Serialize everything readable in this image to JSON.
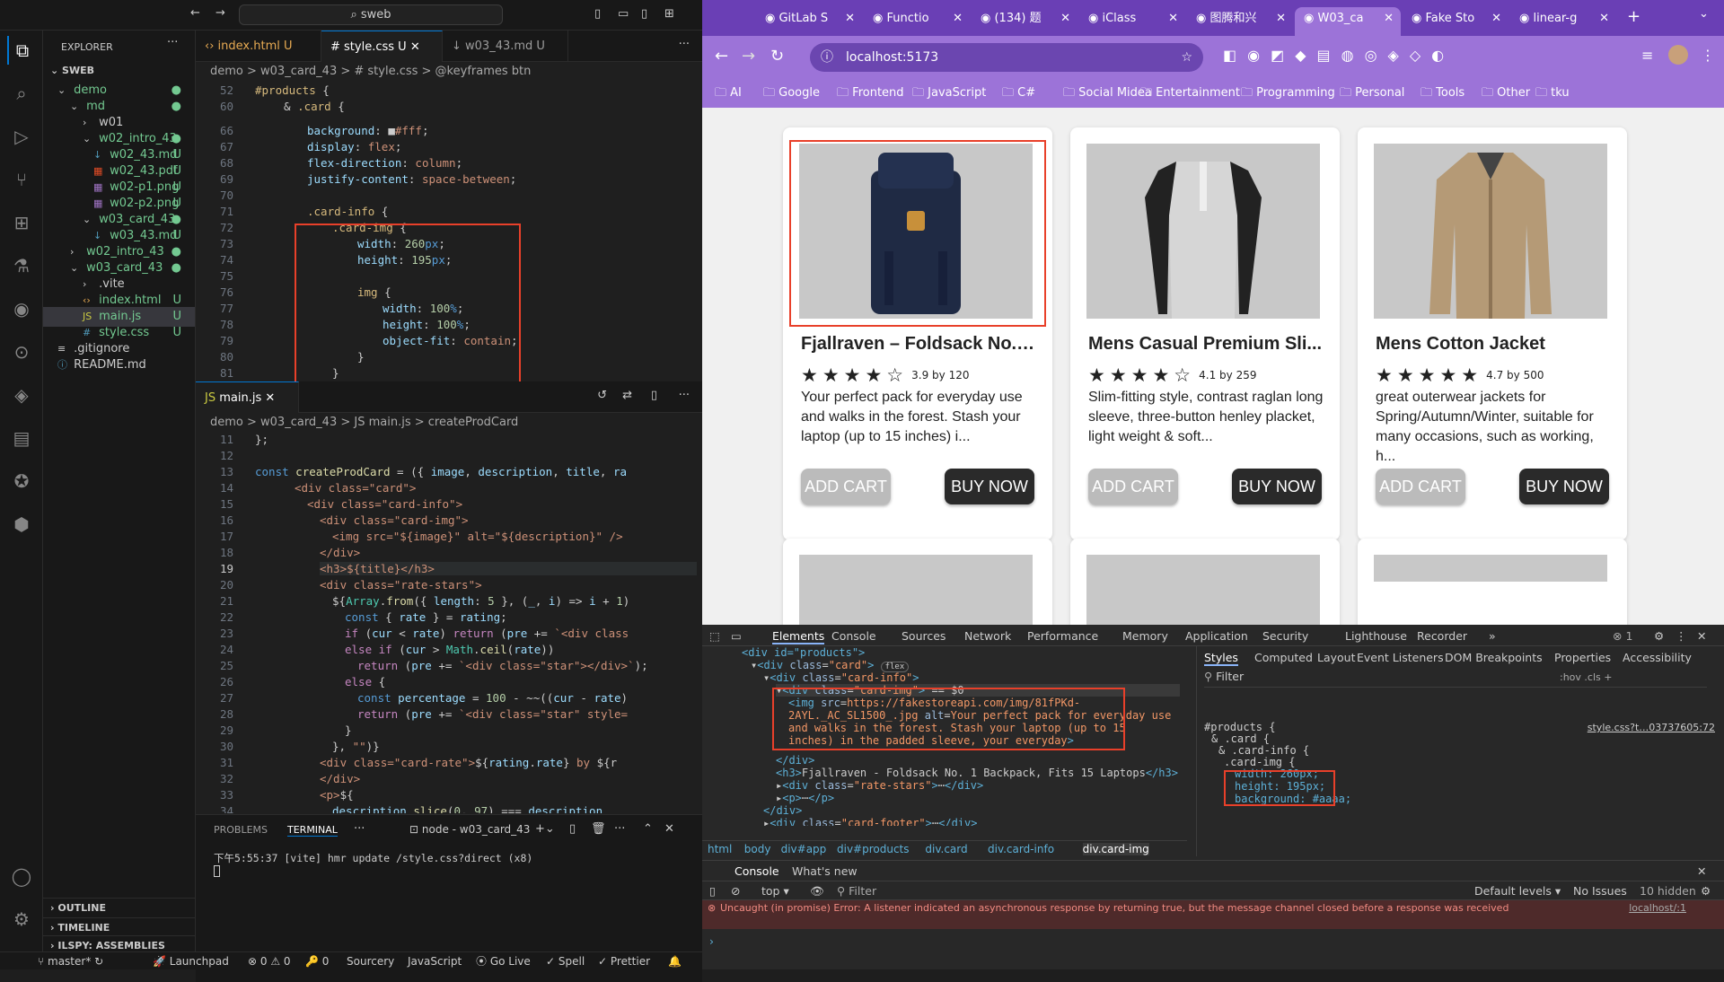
{
  "vscode": {
    "command_center": "sweb",
    "explorer": {
      "title": "EXPLORER",
      "root": "SWEB",
      "items": [
        {
          "label": "demo",
          "badge": "●"
        },
        {
          "label": "md",
          "badge": "●"
        },
        {
          "label": "w01",
          "badge": ""
        },
        {
          "label": "w02_intro_43",
          "badge": "●"
        },
        {
          "label": "w02_43.md",
          "badge": "U"
        },
        {
          "label": "w02_43.pdf",
          "badge": "U"
        },
        {
          "label": "w02-p1.png",
          "badge": "U"
        },
        {
          "label": "w02-p2.png",
          "badge": "U"
        },
        {
          "label": "w03_card_43",
          "badge": "●"
        },
        {
          "label": "w03_43.md",
          "badge": "U"
        },
        {
          "label": "w02_intro_43",
          "badge": "●"
        },
        {
          "label": "w03_card_43",
          "badge": "●"
        },
        {
          "label": ".vite",
          "badge": ""
        },
        {
          "label": "index.html",
          "badge": "U"
        },
        {
          "label": "main.js",
          "badge": "U"
        },
        {
          "label": "style.css",
          "badge": "U"
        },
        {
          "label": ".gitignore",
          "badge": ""
        },
        {
          "label": "README.md",
          "badge": ""
        }
      ],
      "sections": [
        "OUTLINE",
        "TIMELINE",
        "ILSPY: ASSEMBLIES"
      ]
    },
    "top_tabs": [
      "index.html U",
      "style.css U",
      "w03_43.md U"
    ],
    "top_breadcrumb": "demo > w03_card_43 > # style.css > @keyframes btn",
    "bottom_tabs": [
      "main.js"
    ],
    "bottom_breadcrumb": "demo > w03_card_43 > JS main.js > createProdCard",
    "panel": {
      "tabs": [
        "PROBLEMS",
        "TERMINAL"
      ],
      "terminal_name": "node - w03_card_43",
      "terminal_line": "下午5:55:37 [vite] hmr update /style.css?direct (x8)"
    },
    "status": [
      "master*",
      "Launchpad",
      "⊗ 0 ⚠ 0",
      "🔑 0",
      "Sourcery",
      "JavaScript",
      "Go Live",
      "Spell",
      "Prettier"
    ]
  },
  "chrome": {
    "tabs": [
      "GitLab S",
      "Functio",
      "(134) 题",
      "iClass",
      "图腾和兴",
      "W03_ca",
      "Fake Sto",
      "linear-g"
    ],
    "url": "localhost:5173",
    "bookmarks": [
      "AI",
      "Google",
      "Frontend",
      "JavaScript",
      "C#",
      "Social Midea",
      "Entertainment",
      "Programming",
      "Personal",
      "Tools",
      "Other",
      "tku"
    ],
    "products": [
      {
        "title": "Fjallraven – Foldsack No. 1...",
        "stars": "★★★★☆",
        "rating": "3.9 by 120",
        "desc": "Your perfect pack for everyday use and walks in the forest. Stash your laptop (up to 15 inches) i..."
      },
      {
        "title": "Mens Casual Premium Sli...",
        "stars": "★★★★☆",
        "rating": "4.1 by 259",
        "desc": "Slim-fitting style, contrast raglan long sleeve, three-button henley placket, light weight & soft..."
      },
      {
        "title": "Mens Cotton Jacket",
        "stars": "★★★★★",
        "rating": "4.7 by 500",
        "desc": "great outerwear jackets for Spring/Autumn/Winter, suitable for many occasions, such as working, h..."
      }
    ],
    "add_cart": "ADD CART",
    "buy_now": "BUY NOW",
    "devtools": {
      "tabs": [
        "Elements",
        "Console",
        "Sources",
        "Network",
        "Performance",
        "Memory",
        "Application",
        "Security",
        "Lighthouse",
        "Recorder"
      ],
      "styles_tabs": [
        "Styles",
        "Computed",
        "Layout",
        "Event Listeners",
        "DOM Breakpoints",
        "Properties",
        "Accessibility"
      ],
      "filter": "Filter",
      "style_source": "style.css?t…03737605:72",
      "css_rule": [
        "#products {",
        "& .card {",
        "& .card-info {",
        ".card-img {",
        "width: 260px;",
        "height: 195px;",
        "background: #aaaa;"
      ],
      "breadcrumb": [
        "html",
        "body",
        "div#app",
        "div#products",
        "div.card",
        "div.card-info",
        "div.card-img"
      ],
      "console_tabs": [
        "Console",
        "What's new"
      ],
      "console_context": "top",
      "console_levels": "Default levels",
      "console_issues": "No Issues",
      "console_hidden": "10 hidden",
      "console_error": "Uncaught (in promise) Error: A listener indicated an asynchronous response by returning true, but the message channel closed before a response was received",
      "console_src": "localhost/:1",
      "img_src": "https://fakestoreapi.com/img/81fPKd-2AYL._AC_SL1500_.jpg",
      "img_alt": "Your perfect pack for everyday use and walks in the forest. Stash your laptop (up to 15 inches) in the padded sleeve, your everyday",
      "h3_text": "Fjallraven - Foldsack No. 1 Backpack, Fits 15 Laptops"
    }
  }
}
